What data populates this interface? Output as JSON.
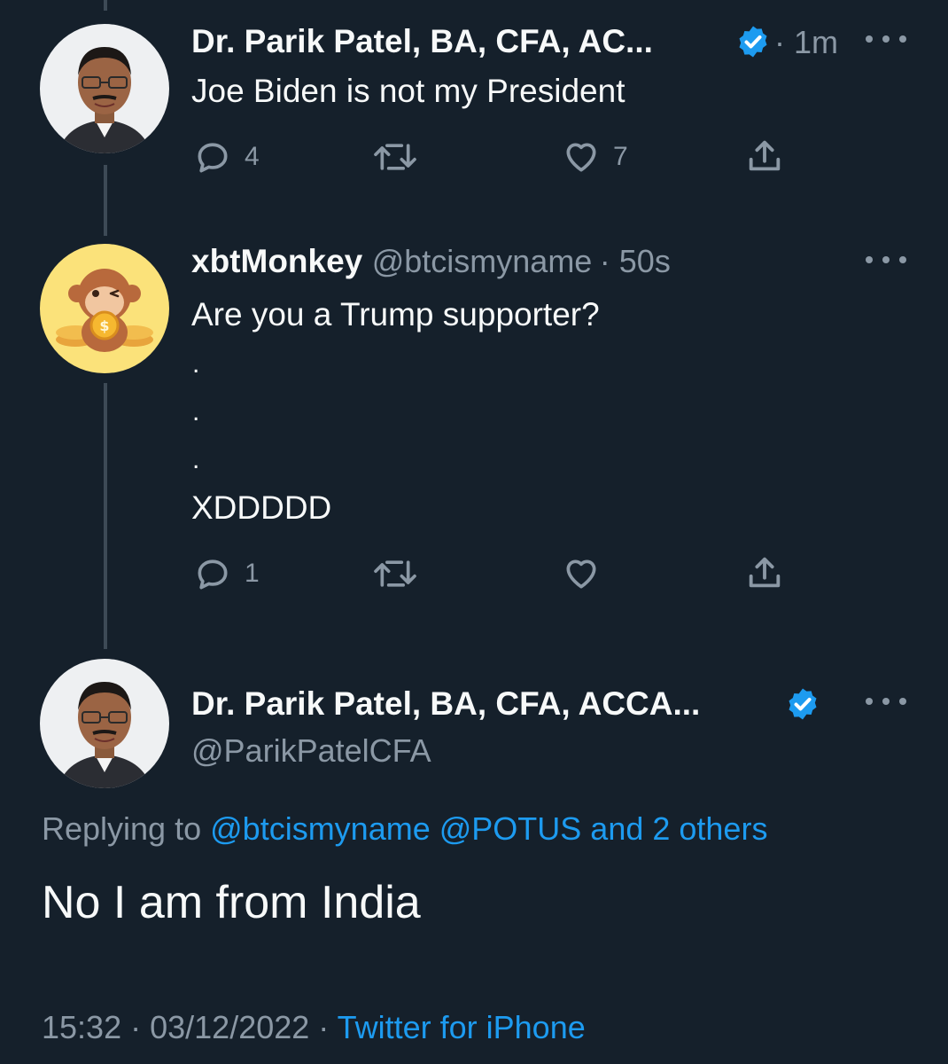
{
  "tweets": [
    {
      "name": "Dr. Parik Patel, BA, CFA, AC...",
      "time": "· 1m",
      "text": "Joe Biden is not my President",
      "reply_count": "4",
      "retweet_count": "",
      "like_count": "7"
    },
    {
      "name": "xbtMonkey",
      "handle": "@btcismyname",
      "time": "· 50s",
      "text": "Are you a Trump supporter?",
      "dots": [
        ".",
        ".",
        "."
      ],
      "text2": "XDDDDD",
      "reply_count": "1",
      "retweet_count": "",
      "like_count": ""
    }
  ],
  "main_tweet": {
    "name": "Dr. Parik Patel, BA, CFA, ACCA...",
    "handle": "@ParikPatelCFA",
    "replying_prefix": "Replying to",
    "replying_users": "@btcismyname @POTUS and 2 others",
    "text": "No I am from India",
    "time": "15:32",
    "date": "· 03/12/2022 ·",
    "source": "Twitter for iPhone"
  },
  "icons": {
    "reply": "reply-icon",
    "retweet": "retweet-icon",
    "like": "heart-icon",
    "share": "share-icon",
    "verified": "verified-badge-icon",
    "more": "more-options-icon"
  },
  "colors": {
    "background": "#15202b",
    "text": "#f7f9f9",
    "muted": "#8b98a5",
    "link": "#1d9bf0",
    "thread_line": "#3d4a56"
  }
}
